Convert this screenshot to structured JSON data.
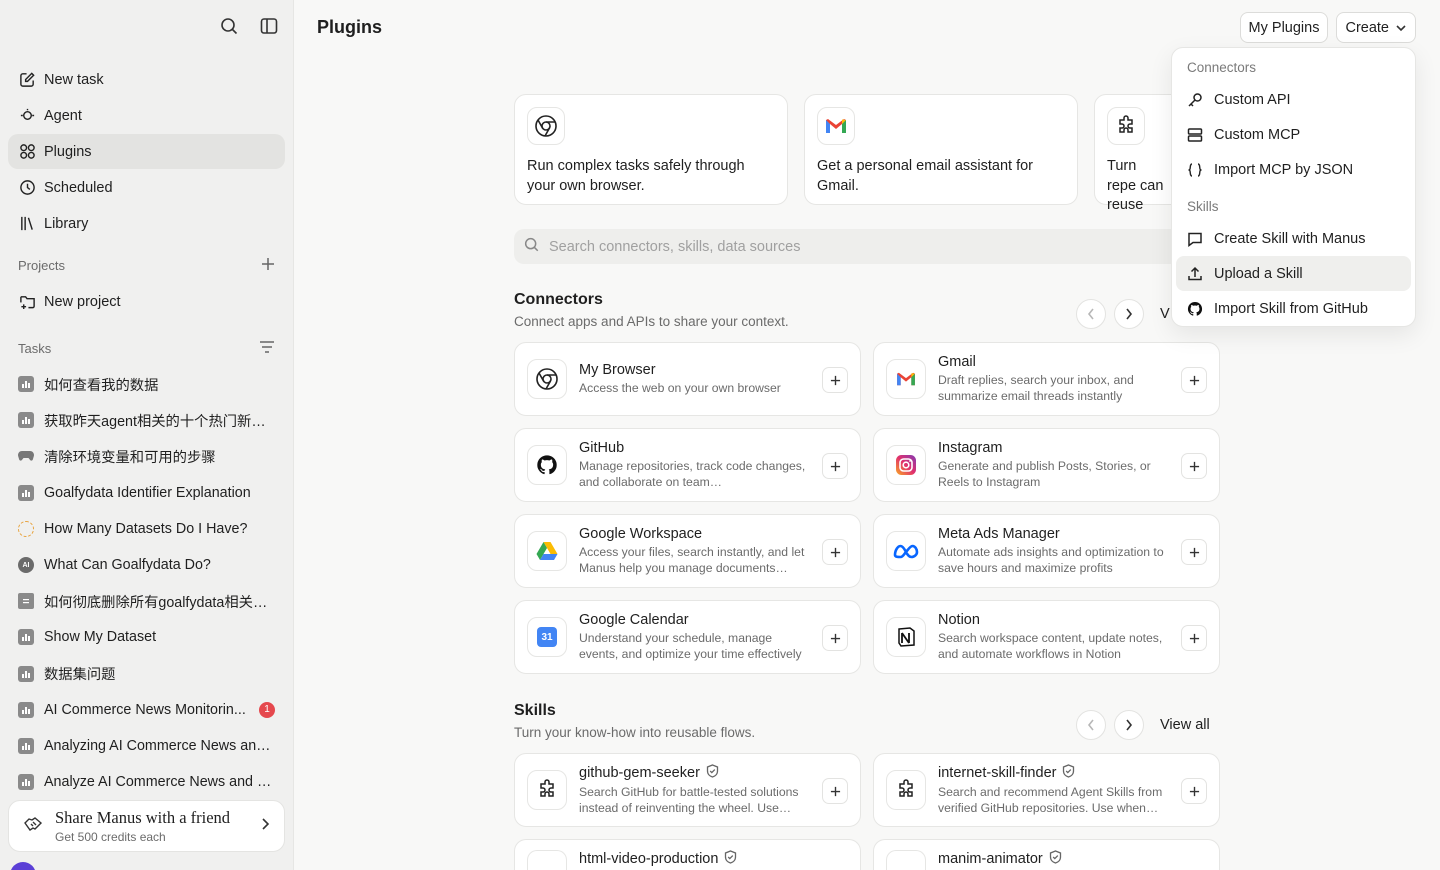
{
  "sidebar": {
    "nav": [
      {
        "label": "New task",
        "icon": "pencil-square-icon"
      },
      {
        "label": "Agent",
        "icon": "agent-icon"
      },
      {
        "label": "Plugins",
        "icon": "grid-icon",
        "active": true
      },
      {
        "label": "Scheduled",
        "icon": "clock-icon"
      },
      {
        "label": "Library",
        "icon": "library-icon"
      }
    ],
    "projects_label": "Projects",
    "new_project": "New project",
    "tasks_label": "Tasks",
    "tasks": [
      {
        "label": "如何查看我的数据",
        "icon": "chart"
      },
      {
        "label": "获取昨天agent相关的十个热门新闻...",
        "icon": "chart"
      },
      {
        "label": "清除环境变量和可用的步骤",
        "icon": "game"
      },
      {
        "label": "Goalfydata Identifier Explanation",
        "icon": "chart"
      },
      {
        "label": "How Many Datasets Do I Have?",
        "icon": "ring"
      },
      {
        "label": "What Can Goalfydata Do?",
        "icon": "ai"
      },
      {
        "label": "如何彻底删除所有goalfydata相关信息",
        "icon": "doc"
      },
      {
        "label": "Show My Dataset",
        "icon": "chart"
      },
      {
        "label": "数据集问题",
        "icon": "chart"
      },
      {
        "label": "AI Commerce News Monitorin...",
        "icon": "chart",
        "badge": "1"
      },
      {
        "label": "Analyzing AI Commerce News and ...",
        "icon": "chart"
      },
      {
        "label": "Analyze AI Commerce News and C...",
        "icon": "chart"
      }
    ],
    "share": {
      "title": "Share Manus with a friend",
      "subtitle": "Get 500 credits each"
    }
  },
  "header": {
    "title": "Plugins",
    "my_plugins": "My Plugins",
    "create": "Create"
  },
  "promos": [
    {
      "text": "Run complex tasks safely through your own browser.",
      "icon": "chrome-icon"
    },
    {
      "text": "Get a personal email assistant for Gmail.",
      "icon": "gmail-icon"
    },
    {
      "text": "Turn repe can reuse",
      "icon": "puzzle-icon"
    }
  ],
  "search": {
    "placeholder": "Search connectors, skills, data sources"
  },
  "connectors": {
    "title": "Connectors",
    "subtitle": "Connect apps and APIs to share your context.",
    "view_all": "V",
    "items": [
      {
        "name": "My Browser",
        "desc": "Access the web on your own browser",
        "icon": "chrome-icon"
      },
      {
        "name": "Gmail",
        "desc": "Draft replies, search your inbox, and summarize email threads instantly",
        "icon": "gmail-icon"
      },
      {
        "name": "GitHub",
        "desc": "Manage repositories, track code changes, and collaborate on team…",
        "icon": "github-icon"
      },
      {
        "name": "Instagram",
        "desc": "Generate and publish Posts, Stories, or Reels to Instagram",
        "icon": "instagram-icon"
      },
      {
        "name": "Google Workspace",
        "desc": "Access your files, search instantly, and let Manus help you manage documents…",
        "icon": "google-drive-icon"
      },
      {
        "name": "Meta Ads Manager",
        "desc": "Automate ads insights and optimization to save hours and maximize profits",
        "icon": "meta-icon"
      },
      {
        "name": "Google Calendar",
        "desc": "Understand your schedule, manage events, and optimize your time effectively",
        "icon": "calendar-icon",
        "day": "31"
      },
      {
        "name": "Notion",
        "desc": "Search workspace content, update notes, and automate workflows in Notion",
        "icon": "notion-icon"
      }
    ]
  },
  "skills": {
    "title": "Skills",
    "subtitle": "Turn your know-how into reusable flows.",
    "view_all": "View all",
    "items": [
      {
        "name": "github-gem-seeker",
        "desc": "Search GitHub for battle-tested solutions instead of reinventing the wheel. Use…",
        "icon": "puzzle-icon"
      },
      {
        "name": "internet-skill-finder",
        "desc": "Search and recommend Agent Skills from verified GitHub repositories. Use when…",
        "icon": "puzzle-icon"
      },
      {
        "name": "html-video-production",
        "desc": "",
        "icon": "puzzle-icon"
      },
      {
        "name": "manim-animator",
        "desc": "",
        "icon": "puzzle-icon"
      }
    ]
  },
  "create_menu": {
    "connectors_label": "Connectors",
    "connectors": [
      {
        "label": "Custom API",
        "icon": "key-icon"
      },
      {
        "label": "Custom MCP",
        "icon": "server-icon"
      },
      {
        "label": "Import MCP by JSON",
        "icon": "braces-icon"
      }
    ],
    "skills_label": "Skills",
    "skills": [
      {
        "label": "Create Skill with Manus",
        "icon": "chat-icon"
      },
      {
        "label": "Upload a Skill",
        "icon": "upload-icon",
        "hover": true
      },
      {
        "label": "Import Skill from GitHub",
        "icon": "github-icon"
      }
    ]
  },
  "colors": {
    "accent_red": "#e5484d",
    "sidebar_bg": "#f0f0ef",
    "page_bg": "#f8f8f7"
  }
}
